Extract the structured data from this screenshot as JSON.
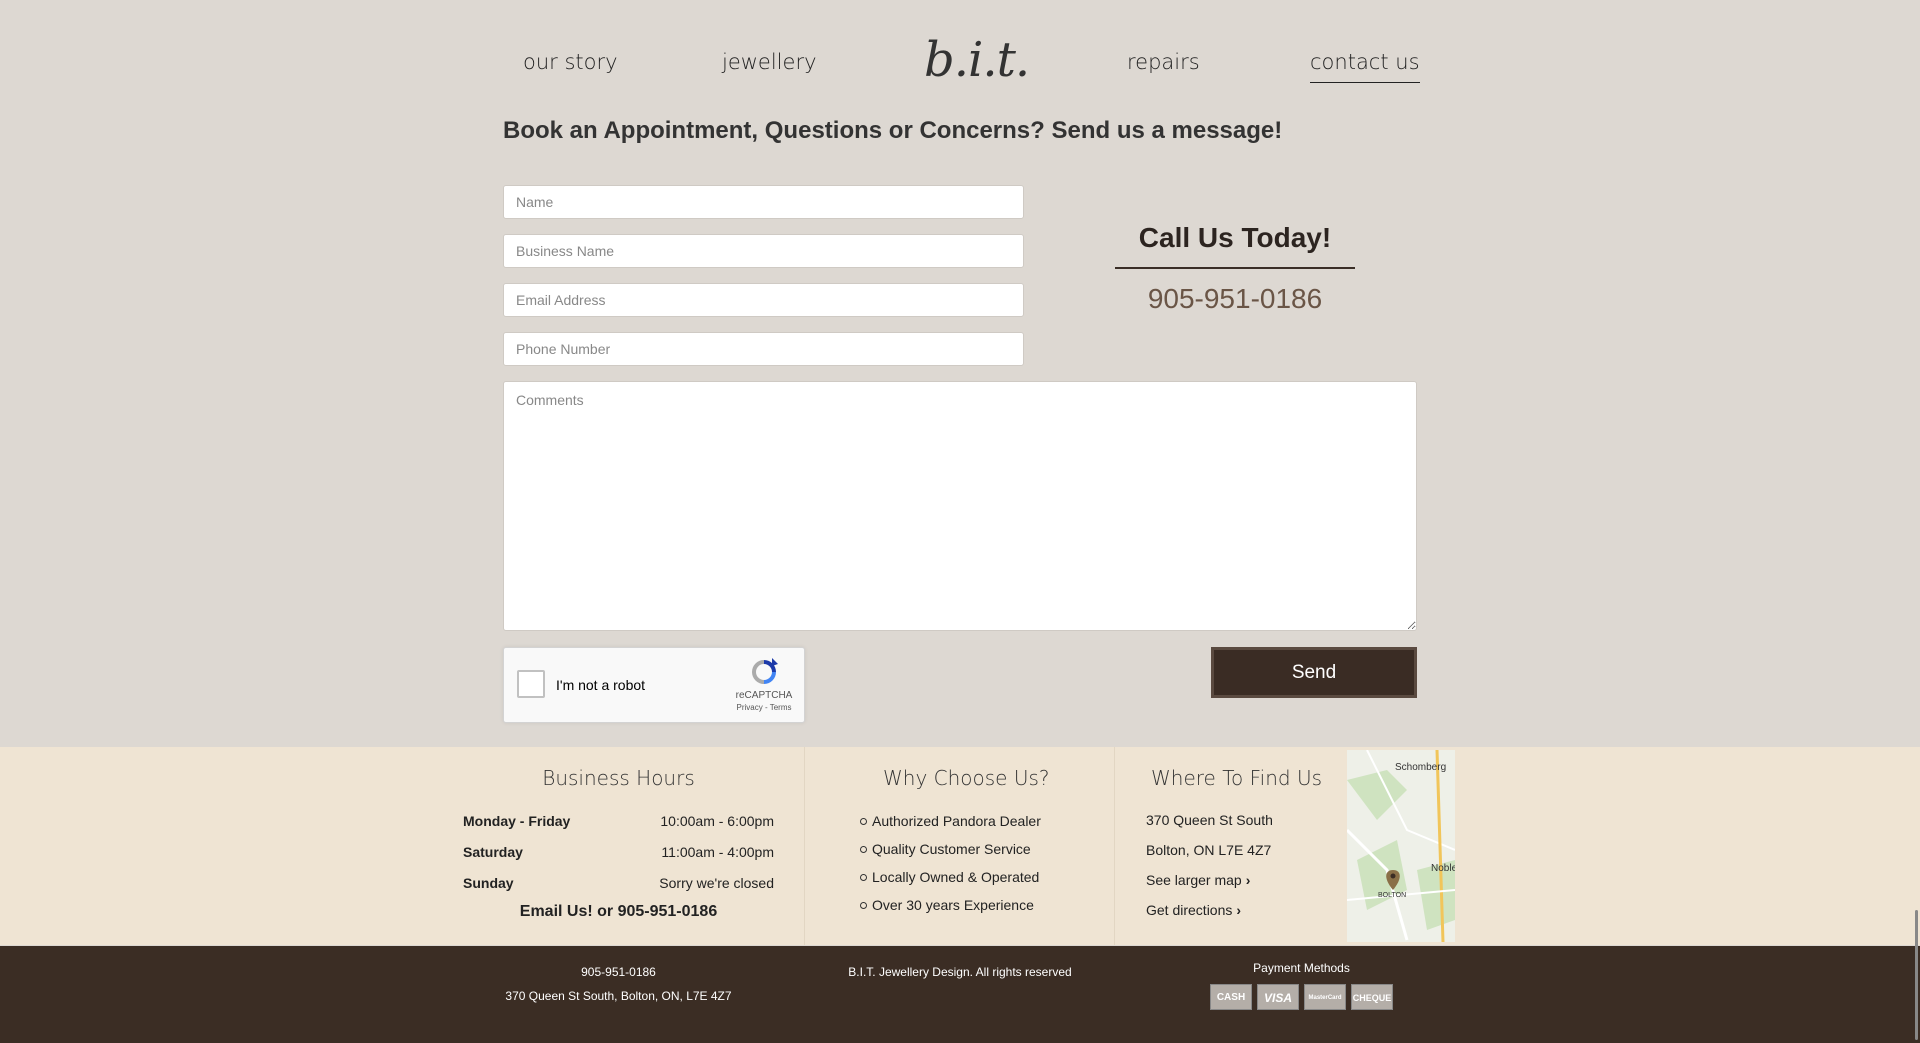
{
  "nav": {
    "our_story": "our story",
    "jewellery": "jewellery",
    "logo": "b.i.t.",
    "repairs": "repairs",
    "contact_us": "contact us"
  },
  "form": {
    "headline": "Book an Appointment, Questions or Concerns? Send us a message!",
    "name_placeholder": "Name",
    "business_placeholder": "Business Name",
    "email_placeholder": "Email Address",
    "phone_placeholder": "Phone Number",
    "comments_placeholder": "Comments",
    "send_label": "Send"
  },
  "recaptcha": {
    "label": "I'm not a robot",
    "brand": "reCAPTCHA",
    "links": "Privacy - Terms"
  },
  "call": {
    "title": "Call Us Today!",
    "phone": "905-951-0186"
  },
  "hours": {
    "title": "Business Hours",
    "rows": [
      {
        "day": "Monday - Friday",
        "time": "10:00am - 6:00pm"
      },
      {
        "day": "Saturday",
        "time": "11:00am - 4:00pm"
      },
      {
        "day": "Sunday",
        "time": "Sorry we're closed"
      }
    ],
    "email_line": "Email Us! or 905-951-0186"
  },
  "why": {
    "title": "Why Choose Us?",
    "items": [
      "Authorized Pandora Dealer",
      "Quality Customer Service",
      "Locally Owned & Operated",
      "Over 30 years Experience"
    ]
  },
  "find": {
    "title": "Where To Find Us",
    "address1": "370 Queen St South",
    "address2": "Bolton, ON L7E 4Z7",
    "larger_map": "See larger map",
    "directions": "Get directions"
  },
  "map": {
    "label_schomberg": "Schomberg",
    "label_nobleton": "Noble",
    "label_bolton": "BOLTON"
  },
  "footer": {
    "phone": "905-951-0186",
    "address": "370 Queen St South, Bolton, ON, L7E 4Z7",
    "copyright": "B.I.T. Jewellery Design. All rights reserved",
    "payment_title": "Payment Methods",
    "payments": [
      "CASH",
      "VISA",
      "MasterCard",
      "CHEQUE"
    ]
  },
  "colors": {
    "page_bg": "#ddd8d2",
    "band_bg": "#efe4d3",
    "footer_bg": "#3b2d24",
    "accent_button": "#3a2c24",
    "phone_color": "#6a5546"
  }
}
